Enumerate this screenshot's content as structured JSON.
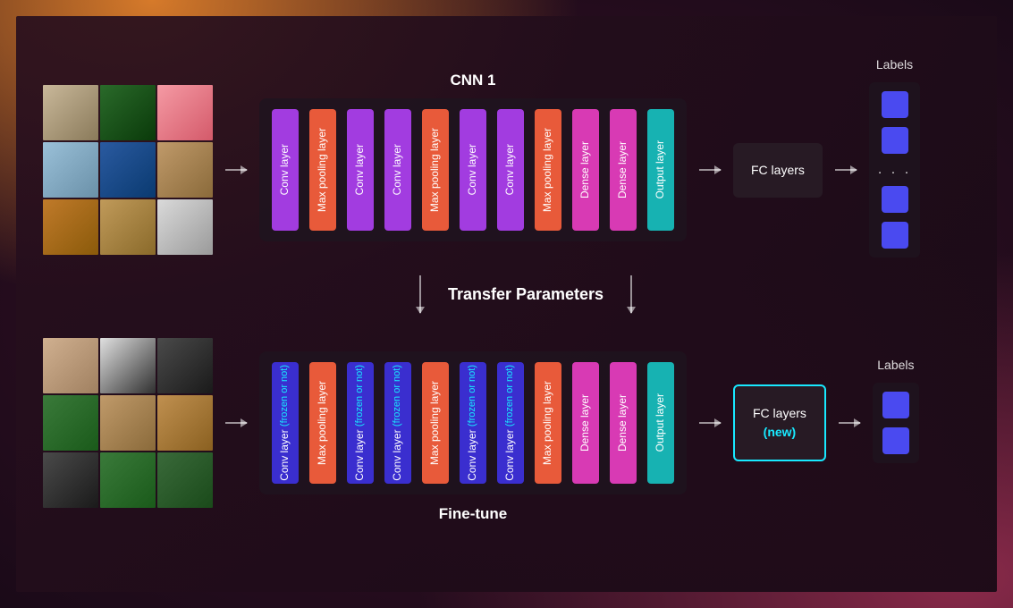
{
  "top": {
    "cnn_title": "CNN 1",
    "fc_label": "FC layers",
    "labels_title": "Labels",
    "layers": [
      {
        "text": "Conv layer",
        "color": "c-purple"
      },
      {
        "text": "Max pooling layer",
        "color": "c-orange"
      },
      {
        "text": "Conv layer",
        "color": "c-purple"
      },
      {
        "text": "Conv layer",
        "color": "c-purple"
      },
      {
        "text": "Max pooling layer",
        "color": "c-orange"
      },
      {
        "text": "Conv layer",
        "color": "c-purple"
      },
      {
        "text": "Conv layer",
        "color": "c-purple"
      },
      {
        "text": "Max pooling layer",
        "color": "c-orange"
      },
      {
        "text": "Dense layer",
        "color": "c-pink"
      },
      {
        "text": "Dense layer",
        "color": "c-pink"
      },
      {
        "text": "Output layer",
        "color": "c-teal"
      }
    ],
    "label_dots": ". . ."
  },
  "transfer_label": "Transfer Parameters",
  "bottom": {
    "cnn_sub": "Fine-tune",
    "fc_label": "FC layers",
    "fc_new": "(new)",
    "labels_title": "Labels",
    "layers": [
      {
        "text": "Conv layer",
        "sub": "(frozen or not)",
        "color": "c-indigo"
      },
      {
        "text": "Max pooling layer",
        "color": "c-orange"
      },
      {
        "text": "Conv layer",
        "sub": "(frozen or not)",
        "color": "c-indigo"
      },
      {
        "text": "Conv layer",
        "sub": "(frozen or not)",
        "color": "c-indigo"
      },
      {
        "text": "Max pooling layer",
        "color": "c-orange"
      },
      {
        "text": "Conv layer",
        "sub": "(frozen or not)",
        "color": "c-indigo"
      },
      {
        "text": "Conv layer",
        "sub": "(frozen or not)",
        "color": "c-indigo"
      },
      {
        "text": "Max pooling layer",
        "color": "c-orange"
      },
      {
        "text": "Dense layer",
        "color": "c-pink"
      },
      {
        "text": "Dense layer",
        "color": "c-pink"
      },
      {
        "text": "Output layer",
        "color": "c-teal"
      }
    ]
  },
  "grid_top_colors": [
    "linear-gradient(135deg,#c9b89a,#8a7a5a)",
    "linear-gradient(135deg,#2a6a2a,#0a3a0a)",
    "linear-gradient(135deg,#f59aa4,#d45a6a)",
    "linear-gradient(135deg,#9ac0d8,#6a90a8)",
    "linear-gradient(135deg,#2a5aa0,#0a3a70)",
    "linear-gradient(135deg,#c09a6a,#8a6a3a)",
    "linear-gradient(135deg,#c07a2a,#8a5a0a)",
    "linear-gradient(135deg,#c09a5a,#8a6a2a)",
    "linear-gradient(135deg,#dadada,#9a9a9a)"
  ],
  "grid_bottom_colors": [
    "linear-gradient(135deg,#d0b090,#a08060)",
    "linear-gradient(135deg,#e0e0e0,#303030)",
    "linear-gradient(135deg,#4a4a4a,#1a1a1a)",
    "linear-gradient(135deg,#3a7a3a,#1a5a1a)",
    "linear-gradient(135deg,#c09a6a,#8a6a3a)",
    "linear-gradient(135deg,#c09050,#8a6020)",
    "linear-gradient(135deg,#4a4a4a,#1a1a1a)",
    "linear-gradient(135deg,#3a7a3a,#1a5a1a)",
    "linear-gradient(135deg,#3a6a3a,#1a4a1a)"
  ]
}
